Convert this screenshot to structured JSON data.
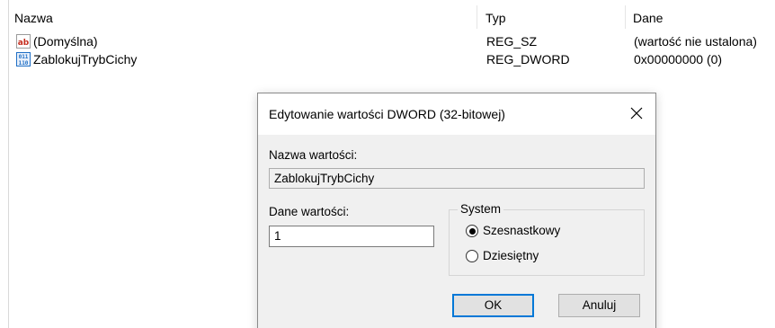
{
  "columns": {
    "name": "Nazwa",
    "type": "Typ",
    "data": "Dane"
  },
  "values": [
    {
      "icon": "string-value-icon",
      "icon_text": "ab",
      "name": "(Domyślna)",
      "type": "REG_SZ",
      "data": "(wartość nie ustalona)"
    },
    {
      "icon": "binary-value-icon",
      "icon_text": "011",
      "name": "ZablokujTrybCichy",
      "type": "REG_DWORD",
      "data": "0x00000000 (0)"
    }
  ],
  "dialog": {
    "title": "Edytowanie wartości DWORD (32-bitowej)",
    "value_name_label": "Nazwa wartości:",
    "value_name": "ZablokujTrybCichy",
    "value_data_label": "Dane wartości:",
    "value_data": "1",
    "base_group_label": "System",
    "base_options": [
      {
        "label": "Szesnastkowy",
        "checked": true
      },
      {
        "label": "Dziesiętny",
        "checked": false
      }
    ],
    "ok_label": "OK",
    "cancel_label": "Anuluj"
  },
  "colors": {
    "accent": "#0078d7",
    "dialog_bg": "#f0f0f0",
    "string_icon": "#c42b1c",
    "binary_icon": "#1f6fc5"
  }
}
